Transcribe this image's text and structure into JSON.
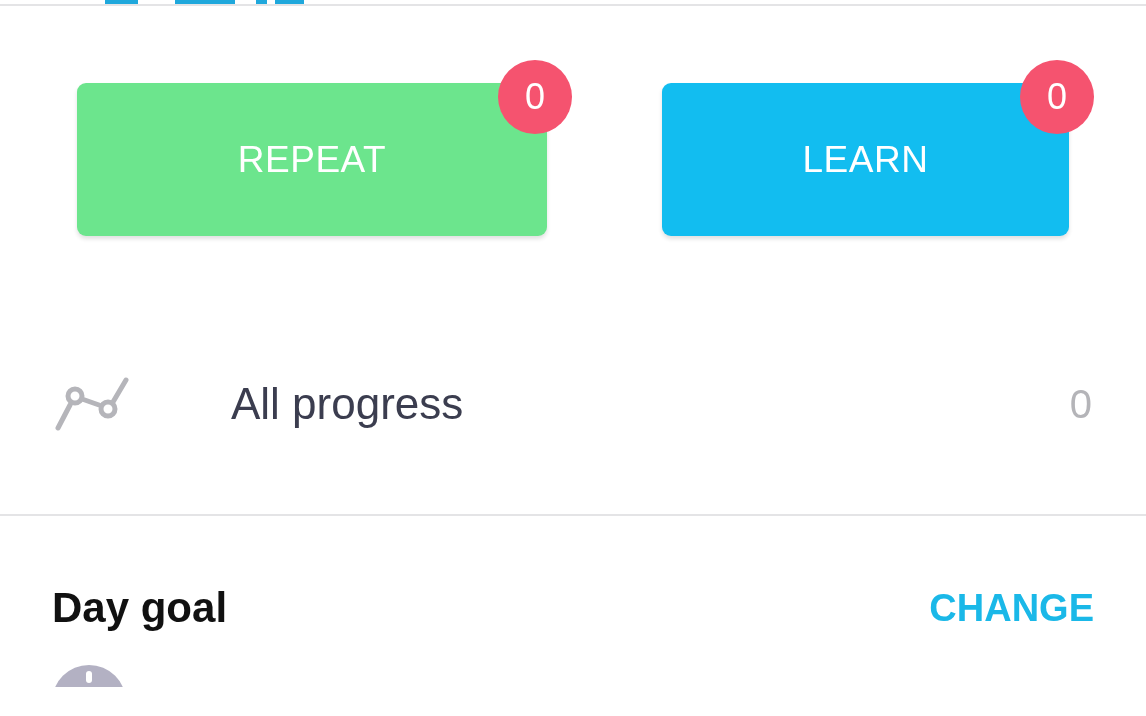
{
  "actions": [
    {
      "kind": "repeat",
      "label": "REPEAT",
      "badge": "0"
    },
    {
      "kind": "learn",
      "label": "LEARN",
      "badge": "0"
    }
  ],
  "progress": {
    "label": "All progress",
    "value": "0"
  },
  "day_goal": {
    "title": "Day goal",
    "action": "CHANGE"
  }
}
